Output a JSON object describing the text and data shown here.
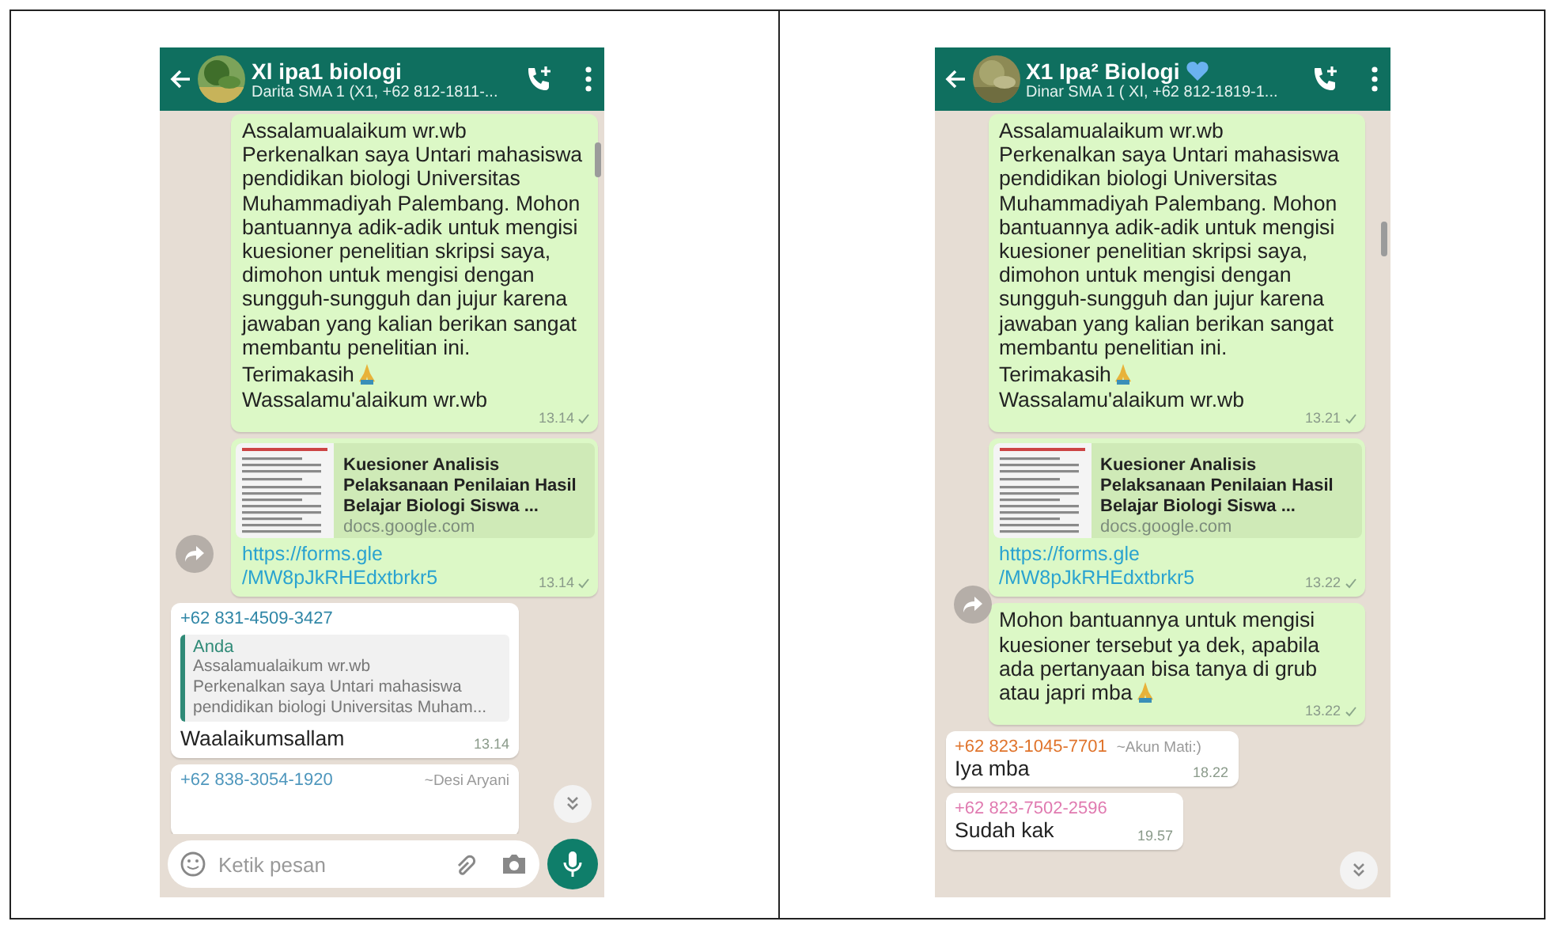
{
  "chats": [
    {
      "header": {
        "title": "Xl ipa1 biologi",
        "heart": false,
        "subtitle": "Darita SMA 1 (X1, +62 812-1811-..."
      },
      "messages": [
        {
          "kind": "text",
          "paragraphs": [
            {
              "text": "Assalamualaikum wr.wb\nPerkenalkan saya Untari mahasiswa\npendidikan biologi Universitas\nMuhammadiyah Palembang. Mohon\nbantuannya adik-adik untuk mengisi\nkuesioner penelitian skripsi saya,\ndimohon untuk mengisi dengan\nsungguh-sungguh dan jujur karena\njawaban yang kalian berikan sangat\nmembantu penelitian ini.",
              "pray": false
            },
            {
              "text": "Terimakasih",
              "pray": true
            },
            {
              "text": "Wassalamu'alaikum wr.wb",
              "pray": false
            }
          ],
          "time": "13.14",
          "sent": true
        },
        {
          "kind": "link",
          "title": "Kuesioner Analisis Pelaksanaan Penilaian Hasil Belajar Biologi Siswa ...",
          "domain": "docs.google.com",
          "url": "https://forms.gle\n/MW8pJkRHEdxtbrkr5",
          "time": "13.14",
          "sent": true
        },
        {
          "kind": "incoming",
          "sender": "+62 831-4509-3427",
          "color": "#2f86a6",
          "quote": {
            "author": "Anda",
            "text": "Assalamualaikum wr.wb\nPerkenalkan saya Untari mahasiswa\npendidikan biologi Universitas Muham..."
          },
          "text": "Waalaikumsallam",
          "time": "13.14"
        },
        {
          "kind": "incoming",
          "sender": "+62 838-3054-1920",
          "alias": "~Desi Aryani",
          "color": "#4f97bd"
        }
      ],
      "composer": {
        "placeholder": "Ketik pesan"
      }
    },
    {
      "header": {
        "title": "X1 Ipa² Biologi",
        "heart": true,
        "subtitle": "Dinar SMA 1 ( XI, +62 812-1819-1..."
      },
      "messages": [
        {
          "kind": "text",
          "paragraphs": [
            {
              "text": "Assalamualaikum wr.wb\nPerkenalkan saya Untari mahasiswa\npendidikan biologi Universitas\nMuhammadiyah Palembang. Mohon\nbantuannya adik-adik untuk mengisi\nkuesioner penelitian skripsi saya,\ndimohon untuk mengisi dengan\nsungguh-sungguh dan jujur karena\njawaban yang kalian berikan sangat\nmembantu penelitian ini.",
              "pray": false
            },
            {
              "text": "Terimakasih",
              "pray": true
            },
            {
              "text": "Wassalamu'alaikum wr.wb",
              "pray": false
            }
          ],
          "time": "13.21",
          "sent": true
        },
        {
          "kind": "link",
          "title": "Kuesioner Analisis Pelaksanaan Penilaian Hasil Belajar Biologi Siswa ...",
          "domain": "docs.google.com",
          "url": "https://forms.gle\n/MW8pJkRHEdxtbrkr5",
          "time": "13.22",
          "sent": true
        },
        {
          "kind": "text",
          "paragraphs": [
            {
              "text": "Mohon bantuannya untuk mengisi\nkuesioner tersebut ya dek, apabila\nada pertanyaan bisa tanya di grub\natau japri mba",
              "pray": true
            }
          ],
          "time": "13.22",
          "sent": true
        },
        {
          "kind": "incoming",
          "sender": "+62 823-1045-7701",
          "alias": "~Akun Mati:)",
          "color": "#e0742c",
          "text": "Iya mba",
          "time": "18.22"
        },
        {
          "kind": "incoming",
          "sender": "+62 823-7502-2596",
          "color": "#e07ab0",
          "text": "Sudah kak",
          "time": "19.57"
        }
      ]
    }
  ]
}
